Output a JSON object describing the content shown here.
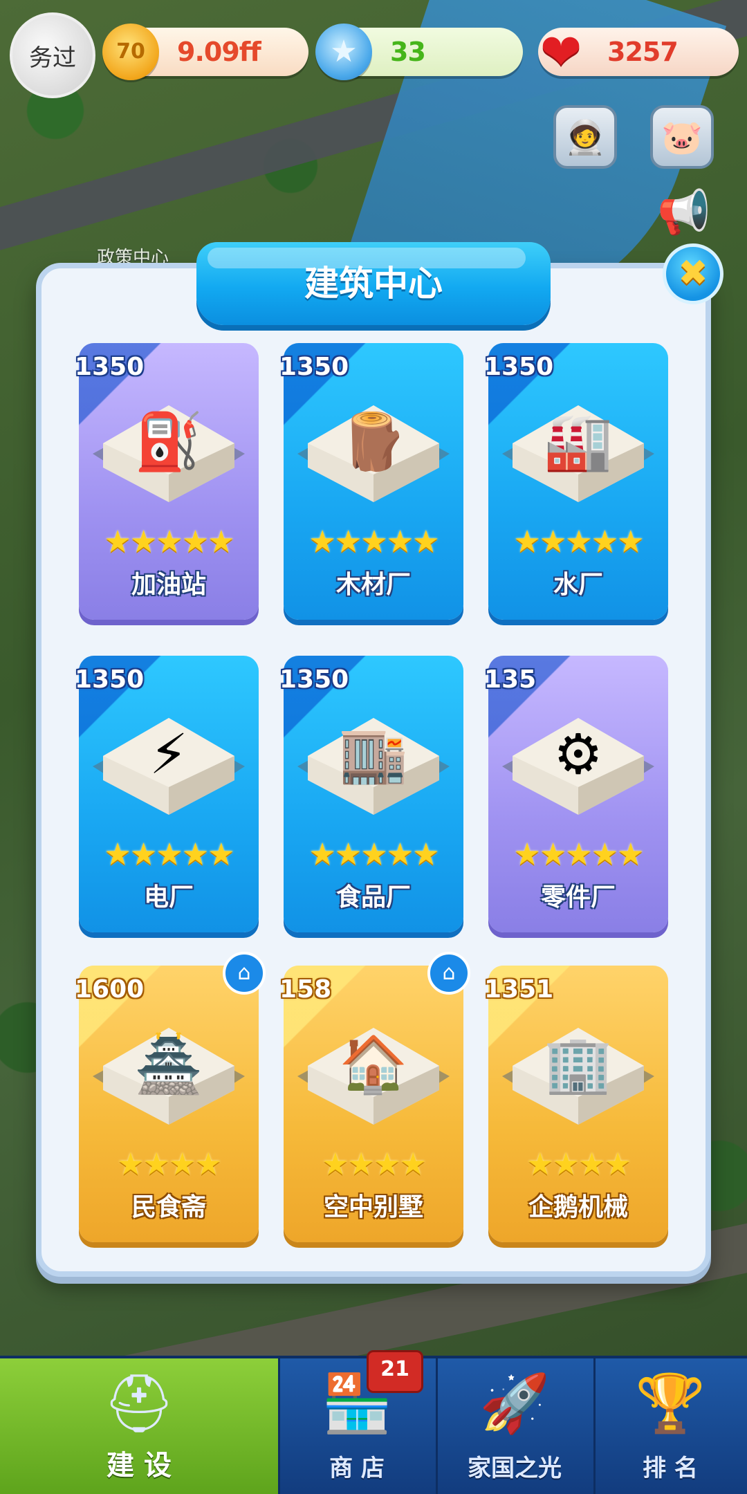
{
  "top_bar": {
    "avatar_text": "务过",
    "gold": "9.09ff",
    "blue_stars": "33",
    "hearts": "3257"
  },
  "background": {
    "policy_label": "政策中心"
  },
  "modal": {
    "title": "建筑中心",
    "cards": [
      {
        "price": "1350",
        "name": "加油站",
        "stars": "★★★★★",
        "theme": "purple",
        "home": false,
        "icon": "gas-station"
      },
      {
        "price": "1350",
        "name": "木材厂",
        "stars": "★★★★★",
        "theme": "blue",
        "home": false,
        "icon": "lumber-mill"
      },
      {
        "price": "1350",
        "name": "水厂",
        "stars": "★★★★★",
        "theme": "blue",
        "home": false,
        "icon": "water-plant"
      },
      {
        "price": "1350",
        "name": "电厂",
        "stars": "★★★★★",
        "theme": "blue",
        "home": false,
        "icon": "power-plant"
      },
      {
        "price": "1350",
        "name": "食品厂",
        "stars": "★★★★★",
        "theme": "blue",
        "home": false,
        "icon": "food-factory"
      },
      {
        "price": "135",
        "name": "零件厂",
        "stars": "★★★★★",
        "theme": "purple",
        "home": false,
        "icon": "parts-factory"
      },
      {
        "price": "1600",
        "name": "民食斋",
        "stars": "★★★★",
        "theme": "gold",
        "home": true,
        "icon": "chinese-pavilion"
      },
      {
        "price": "158",
        "name": "空中别墅",
        "stars": "★★★★",
        "theme": "gold",
        "home": true,
        "icon": "villa"
      },
      {
        "price": "1351",
        "name": "企鹅机械",
        "stars": "★★★★",
        "theme": "gold",
        "home": false,
        "icon": "tower"
      }
    ]
  },
  "nav": {
    "items": [
      {
        "label": "建 设",
        "icon": "hardhat-icon"
      },
      {
        "label": "商 店",
        "icon": "shop-icon"
      },
      {
        "label": "家国之光",
        "icon": "rocket-icon"
      },
      {
        "label": "排 名",
        "icon": "ranking-icon"
      }
    ],
    "shop_badge": "21"
  },
  "colors": {
    "title_blue": "#12a9f1",
    "purple_card": "#9f92f1",
    "blue_card": "#19a7f2",
    "gold_card": "#f6b939"
  }
}
